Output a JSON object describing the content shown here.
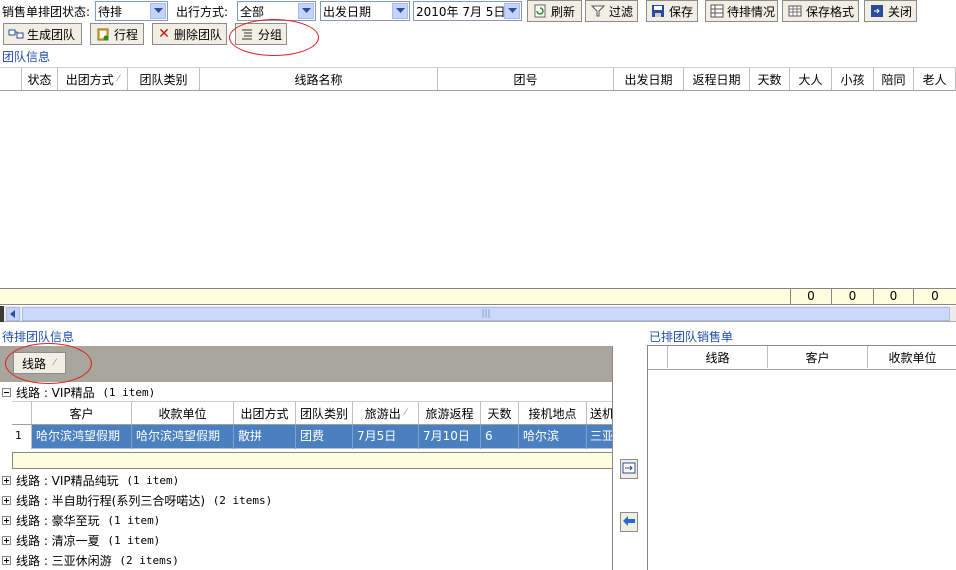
{
  "toolbar1": {
    "status_label": "销售单排团状态:",
    "status_value": "待排",
    "travel_mode_label": "出行方式:",
    "travel_mode_value": "全部",
    "date_type_value": "出发日期",
    "date_value": "2010年 7月 5日",
    "refresh": "刷新",
    "filter": "过滤",
    "save": "保存",
    "pending_status": "待排情况",
    "save_format": "保存格式",
    "close": "关闭"
  },
  "toolbar2": {
    "generate_team": "生成团队",
    "itinerary": "行程",
    "delete_team": "删除团队",
    "group": "分组"
  },
  "team_info": {
    "title": "团队信息",
    "columns": [
      "状态",
      "出团方式",
      "团队类别",
      "线路名称",
      "团号",
      "出发日期",
      "返程日期",
      "天数",
      "大人",
      "小孩",
      "陪同",
      "老人"
    ],
    "totals": [
      "0",
      "0",
      "0",
      "0"
    ]
  },
  "pending": {
    "title": "待排团队信息",
    "group_chip": "线路",
    "groups": [
      {
        "label": "线路 : VIP精品",
        "count": "(1 item)"
      },
      {
        "label": "线路 : VIP精品纯玩",
        "count": "(1 item)"
      },
      {
        "label": "线路 : 半自助行程(系列三合呀喏达)",
        "count": "(2 items)"
      },
      {
        "label": "线路 : 豪华至玩",
        "count": "(1 item)"
      },
      {
        "label": "线路 : 清凉一夏",
        "count": "(1 item)"
      },
      {
        "label": "线路 : 三亚休闲游",
        "count": "(2 items)"
      }
    ],
    "columns": [
      "客户",
      "收款单位",
      "出团方式",
      "团队类别",
      "旅游出",
      "旅游返程",
      "天数",
      "接机地点",
      "送机"
    ],
    "row": {
      "num": "1",
      "cells": [
        "哈尔滨鸿望假期",
        "哈尔滨鸿望假期",
        "散拼",
        "团费",
        "7月5日",
        "7月10日",
        "6",
        "哈尔滨",
        "三亚"
      ]
    }
  },
  "scheduled": {
    "title": "已排团队销售单",
    "columns": [
      "线路",
      "客户",
      "收款单位"
    ]
  },
  "colors": {
    "selection": "#4a7fc0",
    "totals_bar": "#ffffe0",
    "group_panel": "#a8a59c",
    "accent_blue": "#1f4fa8"
  }
}
